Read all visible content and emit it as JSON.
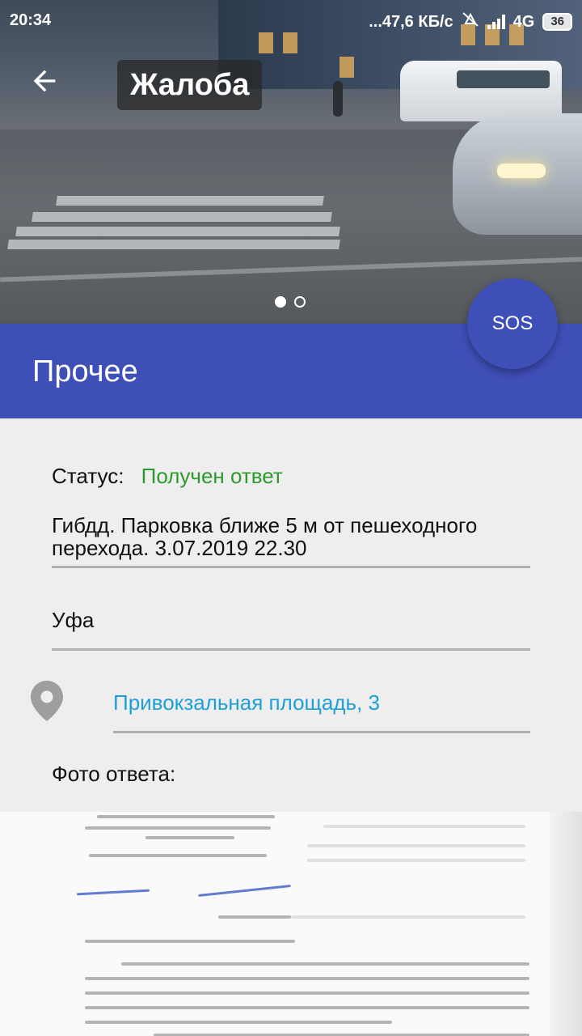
{
  "status_bar": {
    "time": "20:34",
    "network_speed": "...47,6 КБ/с",
    "network_type": "4G",
    "battery": "36"
  },
  "toolbar": {
    "title": "Жалоба",
    "back_icon": "arrow-left-icon"
  },
  "gallery": {
    "pages": 2,
    "current": 1
  },
  "category": {
    "label": "Прочее"
  },
  "sos_button": {
    "label": "SOS"
  },
  "details": {
    "status_label": "Статус:",
    "status_value": "Получен ответ",
    "status_color": "#2e9a2e",
    "description": "Гибдд. Парковка ближе 5 м от пешеходного перехода. 3.07.2019 22.30",
    "city": "Уфа",
    "address": "Привокзальная площадь, 3",
    "address_color": "#1e9fd8",
    "location_icon": "map-pin-icon",
    "answer_photo_label": "Фото ответа:"
  },
  "colors": {
    "primary": "#3f4fb8",
    "background": "#eeeeee"
  }
}
